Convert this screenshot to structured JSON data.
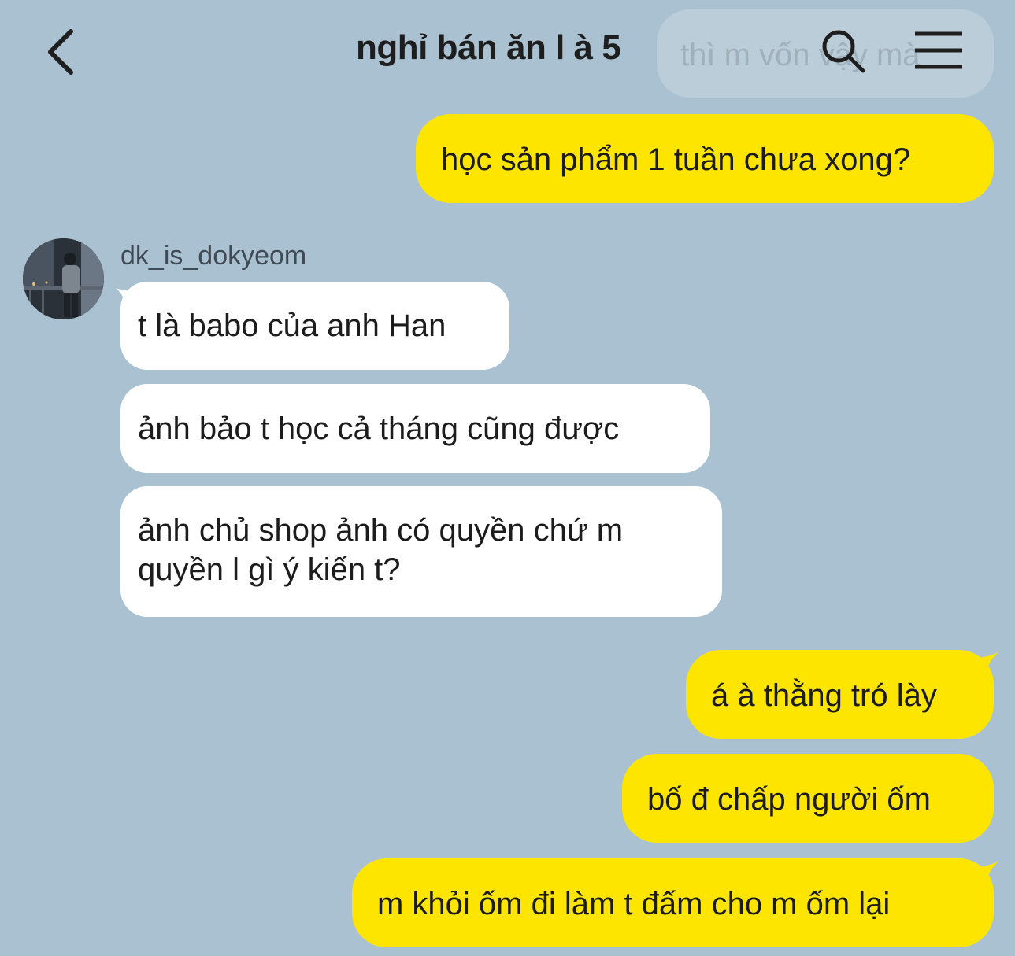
{
  "header": {
    "title": "nghỉ bán ăn l à 5",
    "ghost_text": "thì m vốn vậy mà"
  },
  "conversation": {
    "sender_name": "dk_is_dokyeom",
    "messages": [
      {
        "from": "me",
        "text": "học sản phẩm 1 tuần chưa xong?"
      },
      {
        "from": "them",
        "text": "t là babo của anh Han"
      },
      {
        "from": "them",
        "text": "ảnh bảo t học cả tháng cũng được"
      },
      {
        "from": "them",
        "line1": "ảnh chủ shop ảnh có quyền chứ m",
        "line2": "quyền l gì ý kiến t?"
      },
      {
        "from": "me",
        "text": "á à thằng tró lày"
      },
      {
        "from": "me",
        "text": "bố đ chấp người ốm"
      },
      {
        "from": "me",
        "text": "m khỏi ốm đi làm t đấm cho m ốm lại"
      }
    ]
  },
  "colors": {
    "background": "#aac1d2",
    "my_bubble": "#fee500",
    "their_bubble": "#ffffff"
  },
  "icons": {
    "back": "chevron-left-icon",
    "search": "search-icon",
    "menu": "hamburger-menu-icon"
  }
}
